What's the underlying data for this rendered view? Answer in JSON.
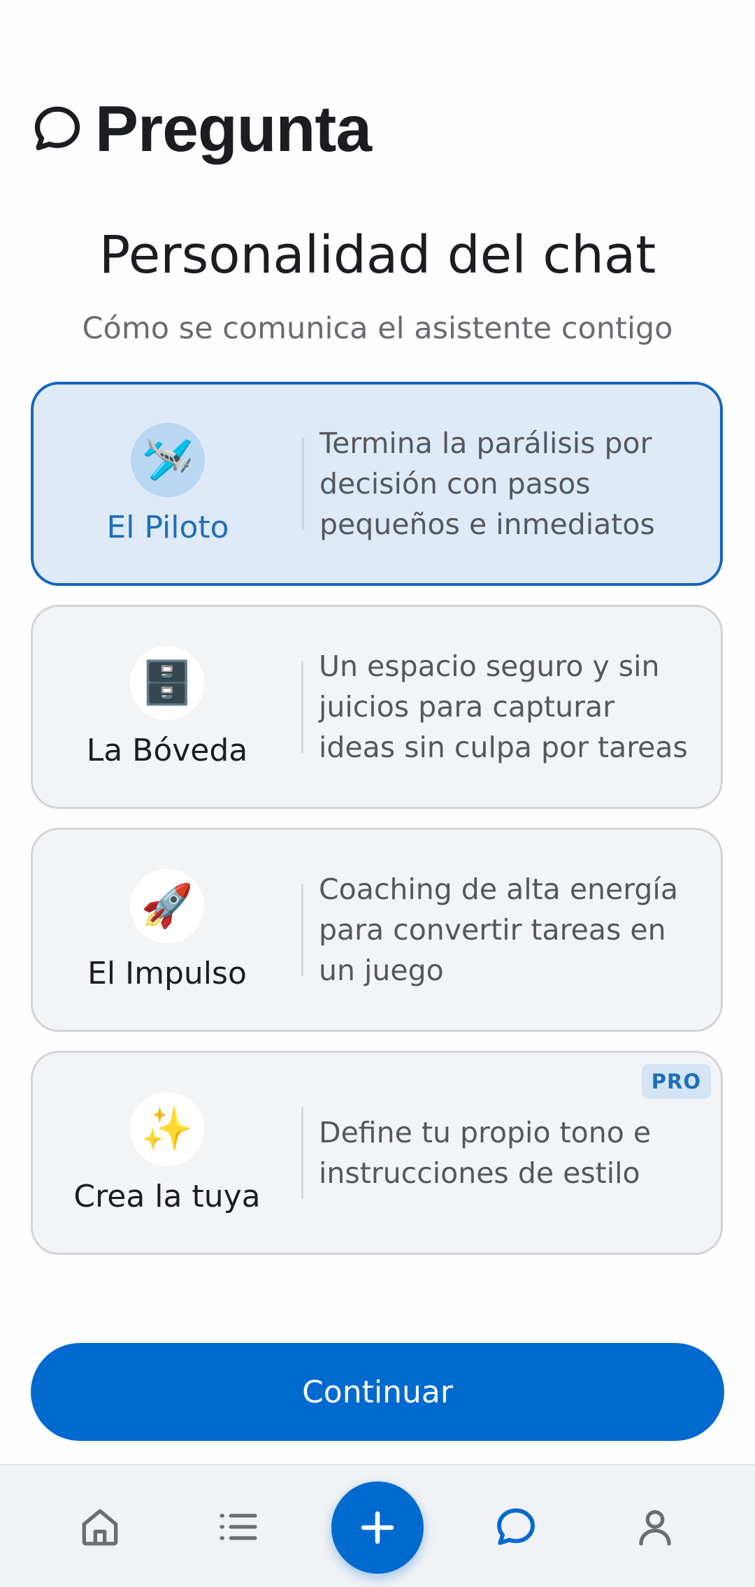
{
  "header": {
    "title": "Pregunta",
    "icon": "chat-bubble-icon"
  },
  "section": {
    "title": "Personalidad del chat",
    "subtitle": "Cómo se comunica el asistente contigo"
  },
  "options": [
    {
      "name": "El Piloto",
      "emoji": "🛩️",
      "icon": "airplane-icon",
      "description": "Termina la parálisis por decisión con pasos pequeños e inmediatos",
      "selected": true
    },
    {
      "name": "La Bóveda",
      "emoji": "🗄️",
      "icon": "file-cabinet-icon",
      "description": "Un espacio seguro y sin juicios para capturar ideas sin culpa por tareas",
      "selected": false
    },
    {
      "name": "El Impulso",
      "emoji": "🚀",
      "icon": "rocket-icon",
      "description": "Coaching de alta energía para convertir tareas en un juego",
      "selected": false
    },
    {
      "name": "Crea la tuya",
      "emoji": "✨",
      "icon": "sparkles-icon",
      "description": "Define tu propio tono e instrucciones de estilo",
      "selected": false,
      "badge": "PRO"
    }
  ],
  "continue_label": "Continuar",
  "nav": {
    "items": [
      "home-icon",
      "list-icon",
      "add-icon",
      "chat-icon",
      "profile-icon"
    ],
    "active": "chat-icon"
  },
  "colors": {
    "accent": "#006acf",
    "selected_bg": "#dfeaf8",
    "selected_border": "#1565c0",
    "card_bg": "#f3f4f6",
    "badge_bg": "#d4e4f5"
  }
}
